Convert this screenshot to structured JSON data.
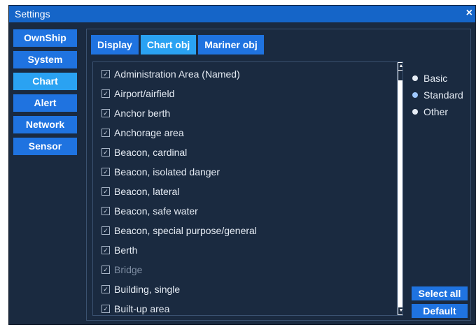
{
  "window": {
    "title": "Settings",
    "close_glyph": "×"
  },
  "nav": {
    "items": [
      {
        "label": "OwnShip",
        "active": false
      },
      {
        "label": "System",
        "active": false
      },
      {
        "label": "Chart",
        "active": true
      },
      {
        "label": "Alert",
        "active": false
      },
      {
        "label": "Network",
        "active": false
      },
      {
        "label": "Sensor",
        "active": false
      }
    ]
  },
  "tabs": [
    {
      "label": "Display",
      "active": false
    },
    {
      "label": "Chart obj",
      "active": true
    },
    {
      "label": "Mariner obj",
      "active": false
    }
  ],
  "objects": [
    {
      "label": "Administration Area (Named)",
      "checked": true,
      "enabled": true
    },
    {
      "label": "Airport/airfield",
      "checked": true,
      "enabled": true
    },
    {
      "label": "Anchor berth",
      "checked": true,
      "enabled": true
    },
    {
      "label": "Anchorage area",
      "checked": true,
      "enabled": true
    },
    {
      "label": "Beacon, cardinal",
      "checked": true,
      "enabled": true
    },
    {
      "label": "Beacon, isolated danger",
      "checked": true,
      "enabled": true
    },
    {
      "label": "Beacon, lateral",
      "checked": true,
      "enabled": true
    },
    {
      "label": "Beacon, safe water",
      "checked": true,
      "enabled": true
    },
    {
      "label": "Beacon, special purpose/general",
      "checked": true,
      "enabled": true
    },
    {
      "label": "Berth",
      "checked": true,
      "enabled": true
    },
    {
      "label": "Bridge",
      "checked": true,
      "enabled": false
    },
    {
      "label": "Building, single",
      "checked": true,
      "enabled": true
    },
    {
      "label": "Built-up area",
      "checked": true,
      "enabled": true
    }
  ],
  "display_category": {
    "options": [
      "Basic",
      "Standard",
      "Other"
    ],
    "selected": "Standard"
  },
  "buttons": {
    "select_all": "Select all",
    "default": "Default"
  },
  "colors": {
    "accent": "#1f73e0",
    "active": "#2aa2f2",
    "background": "#1a2a40",
    "titlebar": "#1565c8"
  }
}
